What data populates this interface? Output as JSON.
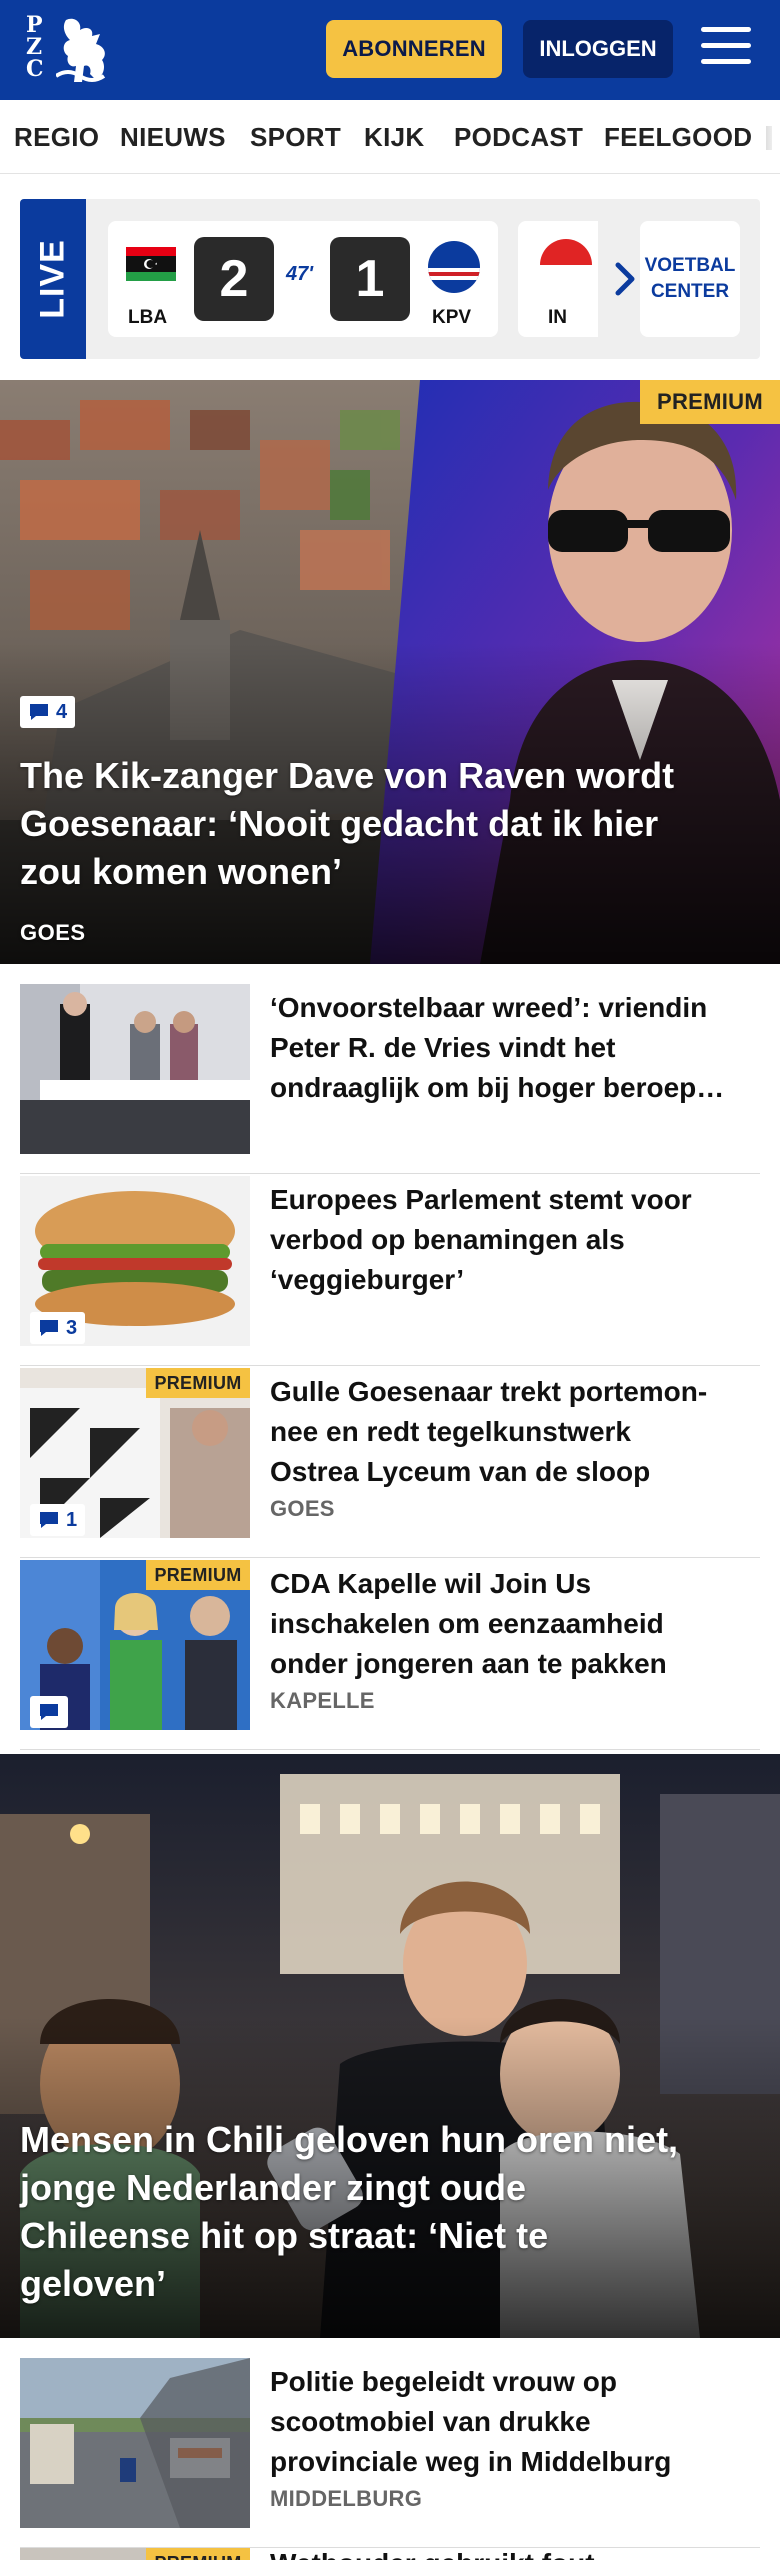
{
  "header": {
    "logo_letters": [
      "P",
      "Z",
      "C"
    ],
    "subscribe_label": "ABONNEREN",
    "login_label": "INLOGGEN"
  },
  "nav": {
    "items": [
      "REGIO",
      "NIEUWS",
      "SPORT",
      "KIJK",
      "PODCAST",
      "FEELGOOD"
    ]
  },
  "live": {
    "label": "LIVE",
    "match1": {
      "home": "LBA",
      "away": "KPV",
      "home_score": "2",
      "away_score": "1",
      "minute": "47'"
    },
    "match2": {
      "home": "IN"
    },
    "center_label_1": "VOETBAL",
    "center_label_2": "CENTER"
  },
  "hero1": {
    "premium": "PREMIUM",
    "comments": "4",
    "title_lines": [
      "The Kik-zanger Dave von Raven wordt",
      "Goesenaar: ‘Nooit gedacht dat ik hier",
      "zou komen wonen’"
    ],
    "place": "GOES"
  },
  "articles": [
    {
      "title_lines": [
        "‘Onvoorstelbaar wreed’: vriendin",
        "Peter R. de Vries vindt het",
        "ondraaglijk om bij hoger beroep…"
      ],
      "place": "",
      "comments": "",
      "premium": ""
    },
    {
      "title_lines": [
        "Europees Parlement stemt voor",
        "verbod op benamingen als",
        "‘veggieburger’"
      ],
      "place": "",
      "comments": "3",
      "premium": ""
    },
    {
      "title_lines": [
        "Gulle Goesenaar trekt portemon-",
        "nee en redt tegelkunstwerk",
        "Ostrea Lyceum van de sloop"
      ],
      "place": "GOES",
      "comments": "1",
      "premium": "PREMIUM"
    },
    {
      "title_lines": [
        "CDA Kapelle wil Join Us",
        "inschakelen om eenzaamheid",
        "onder jongeren aan te pakken"
      ],
      "place": "KAPELLE",
      "comments": "",
      "premium": "PREMIUM"
    }
  ],
  "hero2": {
    "title_lines": [
      "Mensen in Chili geloven hun oren niet,",
      "jonge Nederlander zingt oude",
      "Chileense hit op straat: ‘Niet te",
      "geloven’"
    ]
  },
  "article5": {
    "title_lines": [
      "Politie begeleidt vrouw op",
      "scootmobiel van drukke",
      "provinciale weg in Middelburg"
    ],
    "place": "MIDDELBURG"
  },
  "article6": {
    "premium": "PREMIUM",
    "title_partial": "Wethouder gebruikt fout"
  },
  "colors": {
    "brand_blue": "#0b3b9e",
    "premium_yellow": "#f5c242",
    "login_navy": "#07246a"
  }
}
